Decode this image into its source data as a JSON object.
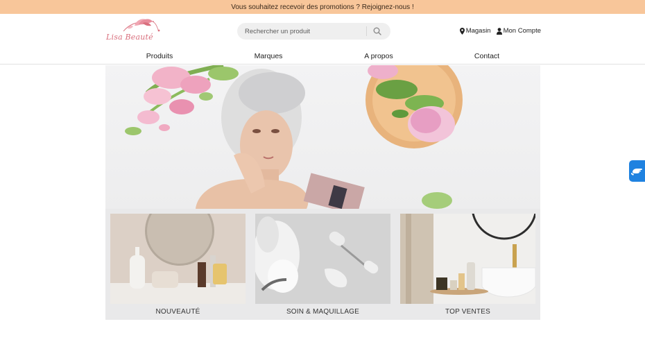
{
  "promo": {
    "text": "Vous souhaitez recevoir des promotions ? Rejoignez-nous !"
  },
  "brand": {
    "logo_text": "Lisa Beauté"
  },
  "search": {
    "placeholder": "Rechercher un produit",
    "icon": "search-icon"
  },
  "header_links": [
    {
      "label": "Magasin",
      "icon": "map-pin-icon"
    },
    {
      "label": "Mon Compte",
      "icon": "user-icon"
    }
  ],
  "nav": {
    "items": [
      "Produits",
      "Marques",
      "A propos",
      "Contact"
    ]
  },
  "categories": [
    {
      "label": "NOUVEAUTÉ"
    },
    {
      "label": "SOIN & MAQUILLAGE"
    },
    {
      "label": "TOP VENTES"
    }
  ],
  "colors": {
    "promo_bar": "#f8c69a",
    "brand_pink": "#d9707e",
    "floating_tab": "#1f82e0"
  },
  "floating_tab": {
    "icon": "hand-icon"
  }
}
